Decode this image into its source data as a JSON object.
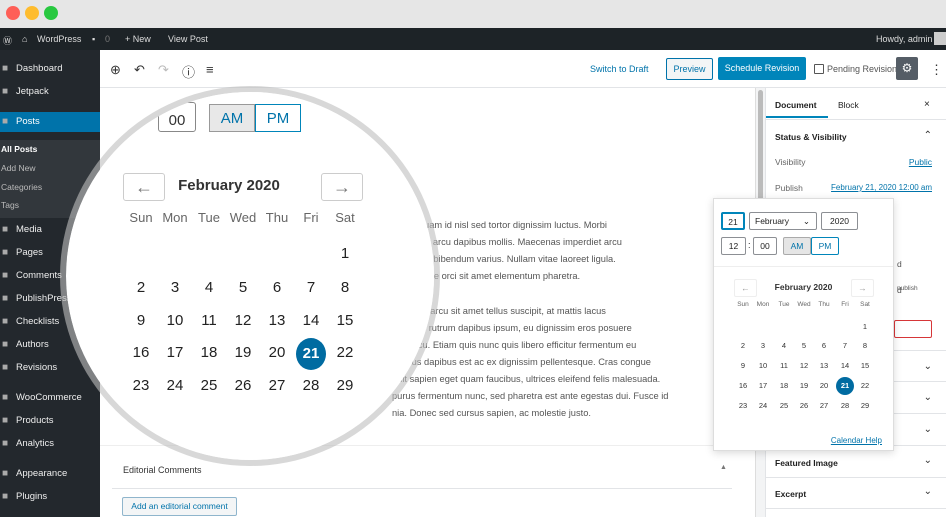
{
  "admin_bar": {
    "site": "WordPress",
    "comments": "0",
    "new": "+ New",
    "view_post": "View Post",
    "greeting": "Howdy, admin"
  },
  "sidebar": {
    "items": [
      {
        "label": "Dashboard",
        "icon": "dashboard-icon"
      },
      {
        "label": "Jetpack",
        "icon": "jetpack-icon"
      },
      {
        "label": "Posts",
        "icon": "pin-icon"
      },
      {
        "label": "Media",
        "icon": "media-icon"
      },
      {
        "label": "Pages",
        "icon": "pages-icon"
      },
      {
        "label": "Comments",
        "icon": "comments-icon"
      },
      {
        "label": "PublishPress",
        "icon": "calendar-icon"
      },
      {
        "label": "Checklists",
        "icon": "check-icon"
      },
      {
        "label": "Authors",
        "icon": "authors-icon"
      },
      {
        "label": "Revisions",
        "icon": "clock-icon"
      },
      {
        "label": "WooCommerce",
        "icon": "woo-icon"
      },
      {
        "label": "Products",
        "icon": "box-icon"
      },
      {
        "label": "Analytics",
        "icon": "bar-chart-icon"
      },
      {
        "label": "Appearance",
        "icon": "brush-icon"
      },
      {
        "label": "Plugins",
        "icon": "plug-icon"
      }
    ],
    "submenu": [
      "All Posts",
      "Add New",
      "Categories",
      "Tags"
    ]
  },
  "toolbar": {
    "switch_draft": "Switch to Draft",
    "preview": "Preview",
    "schedule": "Schedule Revision",
    "pending": "Pending Revision"
  },
  "panel": {
    "tabs": [
      "Document",
      "Block"
    ],
    "close": "×",
    "status_title": "Status & Visibility",
    "visibility_label": "Visibility",
    "visibility_value": "Public",
    "publish_label": "Publish",
    "publish_value": "February 21, 2020 12:00 am",
    "hidden_d": "d",
    "hidden_d2": "d",
    "hidden_publish": "publish",
    "featured_image": "Featured Image",
    "excerpt": "Excerpt"
  },
  "content": {
    "lines": [
      "elit. Aliquam id nisl sed tortor dignissim luctus. Morbi",
      "erat vitae arcu dapibus mollis. Maecenas imperdiet arcu",
      "eget eros bibendum varius. Nullam vitae laoreet ligula.",
      "scelerisque orci sit amet elementum pharetra.",
      "convallis arcu sit amet tellus suscipit, at mattis lacus",
      "hasellus rutrum dapibus ipsum, eu dignissim eros posuere",
      "san arcu. Etiam quis nunc quis libero efficitur fermentum eu",
      "ivamus dapibus est ac ex dignissim pellentesque. Cras congue",
      "ndit sapien eget quam faucibus, ultrices eleifend felis malesuada.",
      "purus fermentum nunc, sed pharetra est ante egestas dui. Fusce id",
      "nia. Donec sed cursus sapien, ac molestie justo."
    ],
    "editorial_title": "Editorial Comments",
    "add_comment": "Add an editorial comment"
  },
  "picker": {
    "day": "21",
    "month": "February",
    "year": "2020",
    "hour": "12",
    "minute": "00",
    "sep": ":",
    "am": "AM",
    "pm": "PM",
    "title": "February 2020",
    "prev": "←",
    "next": "→",
    "weekdays": [
      "Sun",
      "Mon",
      "Tue",
      "Wed",
      "Thu",
      "Fri",
      "Sat"
    ],
    "weeks": [
      [
        "",
        "",
        "",
        "",
        "",
        "",
        "1"
      ],
      [
        "2",
        "3",
        "4",
        "5",
        "6",
        "7",
        "8"
      ],
      [
        "9",
        "10",
        "11",
        "12",
        "13",
        "14",
        "15"
      ],
      [
        "16",
        "17",
        "18",
        "19",
        "20",
        "21",
        "22"
      ],
      [
        "23",
        "24",
        "25",
        "26",
        "27",
        "28",
        "29"
      ]
    ],
    "selected": "21",
    "help": "Calendar Help"
  },
  "colors": {
    "accent": "#0073aa",
    "admin_dark": "#23282d",
    "selected_day": "#006ba1"
  }
}
